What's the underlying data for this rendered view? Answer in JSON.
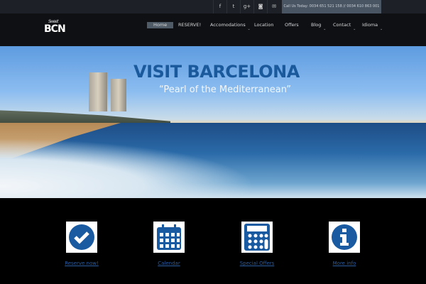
{
  "topbar": {
    "social": [
      {
        "icon": "facebook-icon",
        "glyph": "f"
      },
      {
        "icon": "twitter-icon",
        "glyph": "t"
      },
      {
        "icon": "google-plus-icon",
        "glyph": "g+"
      },
      {
        "icon": "instagram-icon",
        "glyph": "◙"
      },
      {
        "icon": "email-icon",
        "glyph": "✉"
      }
    ],
    "call": "Call Us Today: 0034 651 521 158 // 0034 610 863 001"
  },
  "logo": {
    "script": "Sweet",
    "text": "BCN"
  },
  "nav": [
    {
      "label": "Home"
    },
    {
      "label": "RESERVE!"
    },
    {
      "label": "Accomodations"
    },
    {
      "label": "Location"
    },
    {
      "label": "Offers"
    },
    {
      "label": "Blog"
    },
    {
      "label": "Contact"
    },
    {
      "label": "Idioma"
    }
  ],
  "hero": {
    "title": "VISIT BARCELONA",
    "subtitle": "“Pearl of the Mediterranean”"
  },
  "features": [
    {
      "label": "Reserve now!",
      "icon": "checkmark-icon"
    },
    {
      "label": "Calendar",
      "icon": "calendar-icon"
    },
    {
      "label": "Special Offers",
      "icon": "calculator-icon"
    },
    {
      "label": "More info",
      "icon": "info-icon"
    }
  ],
  "colors": {
    "accent": "#1a5a9c",
    "nav_bg": "#0e1014",
    "topbar_bg": "#1d2127"
  }
}
